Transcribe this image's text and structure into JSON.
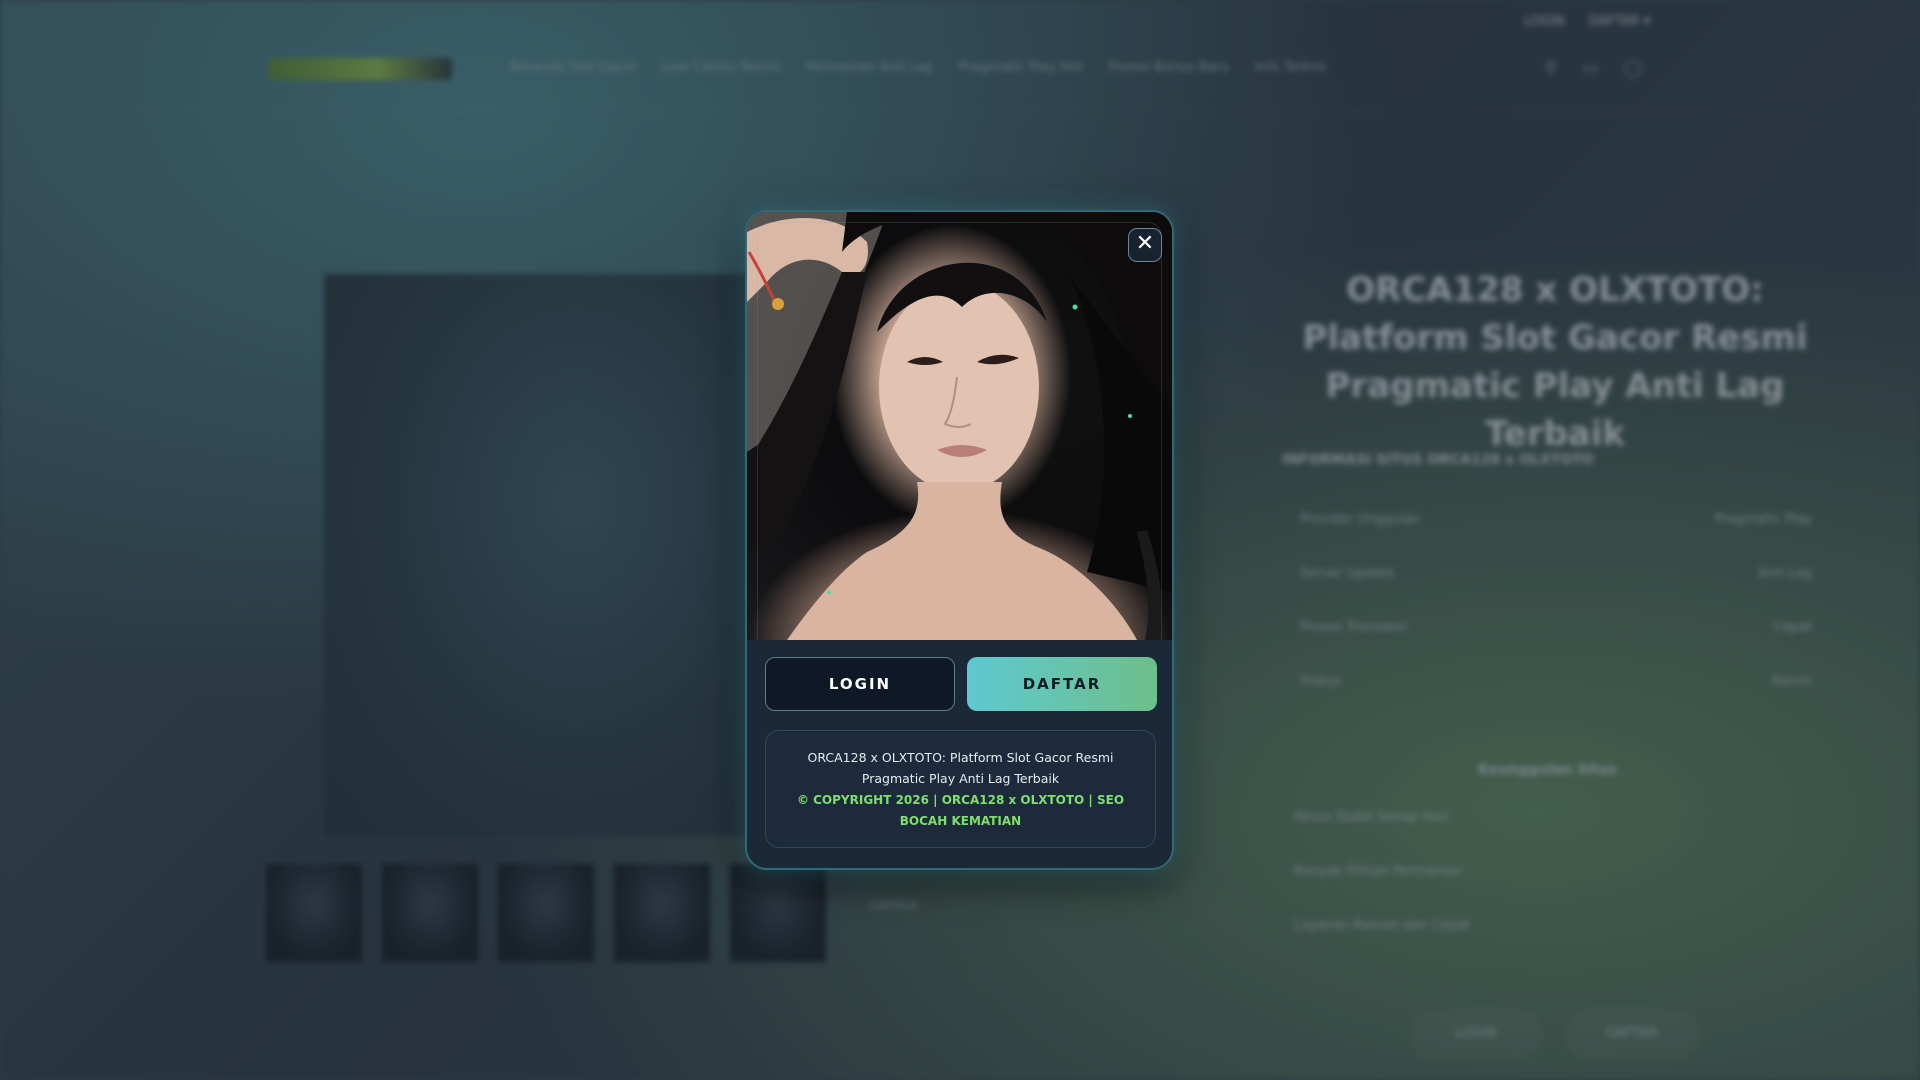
{
  "colors": {
    "modal_bg": "#1a2838",
    "modal_border": "#2f6a76",
    "login_bg": "#0e1826",
    "daftar_gradient_start": "#5fc9d0",
    "daftar_gradient_end": "#6dbf8a",
    "copyright_green": "#7ee06a"
  },
  "background_page": {
    "top_links": [
      "LOGIN",
      "DAFTAR ▾"
    ],
    "nav_items": [
      "Beranda Slot Gacor",
      "Live Casino Resmi",
      "Permainan Anti Lag",
      "Pragmatic Play Hot",
      "Promo Bonus Baru",
      "Info Terkini"
    ],
    "header_icons": [
      "search-icon",
      "cart-icon",
      "user-icon"
    ],
    "title": "ORCA128 x OLXTOTO: Platform Slot Gacor Resmi Pragmatic Play Anti Lag Terbaik",
    "subheading": "INFORMASI SITUS ORCA128 x OLXTOTO",
    "table_rows": [
      {
        "label": "Provider Unggulan",
        "value": "Pragmatic Play"
      },
      {
        "label": "Server Update",
        "value": "Anti Lag"
      },
      {
        "label": "Proses Transaksi",
        "value": "Cepat"
      },
      {
        "label": "Status",
        "value": "Resmi"
      }
    ],
    "section_title": "Keunggulan Situs",
    "list_items": [
      "Akses Stabil Setiap Hari",
      "Banyak Pilihan Permainan",
      "Layanan Ramah dan Cepat"
    ],
    "more_label": "Lainnya",
    "bottom_buttons": [
      "LOGIN",
      "DAFTAR"
    ]
  },
  "modal": {
    "close_label": "✕",
    "login_label": "LOGIN",
    "daftar_label": "DAFTAR",
    "description": "ORCA128 x OLXTOTO: Platform Slot Gacor Resmi Pragmatic Play Anti Lag Terbaik",
    "copyright": "© COPYRIGHT 2026 | ORCA128 x OLXTOTO | SEO BOCAH KEMATIAN"
  }
}
